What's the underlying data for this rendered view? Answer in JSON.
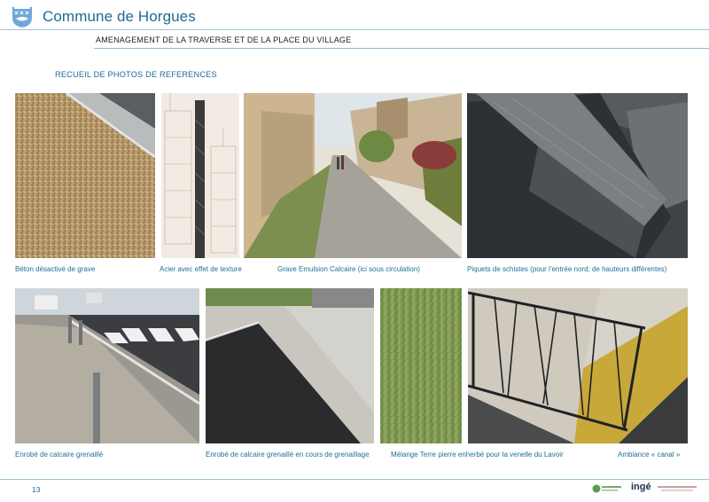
{
  "header": {
    "commune": "Commune de Horgues",
    "subtitle": "AMENAGEMENT DE LA TRAVERSE ET DE LA PLACE DU VILLAGE"
  },
  "section_title": "RECUEIL DE PHOTOS DE REFERENCES",
  "captions": {
    "c1": "Béton désactivé de grave",
    "c2": "Acier avec effet de texture",
    "c3": "Grave Emulsion Calcaire (ici sous circulation)",
    "c4": "Piquets de schistes (pour l’entrée nord; de hauteurs différentes)",
    "c5": "Enrobé de calcaire grenaillé",
    "c6": "Enrobé de calcaire grenaillé en cours de grenaillage",
    "c7": "Mélange Terre pierre enherbé pour la venelle du Lavoir",
    "c8": "Ambiance « canal »"
  },
  "footer": {
    "page_number": "13",
    "partner_logo_2": "ingé"
  },
  "colors": {
    "brand_blue": "#1d6b93",
    "rule": "#9fc3d3",
    "caption": "#1f6f98"
  }
}
